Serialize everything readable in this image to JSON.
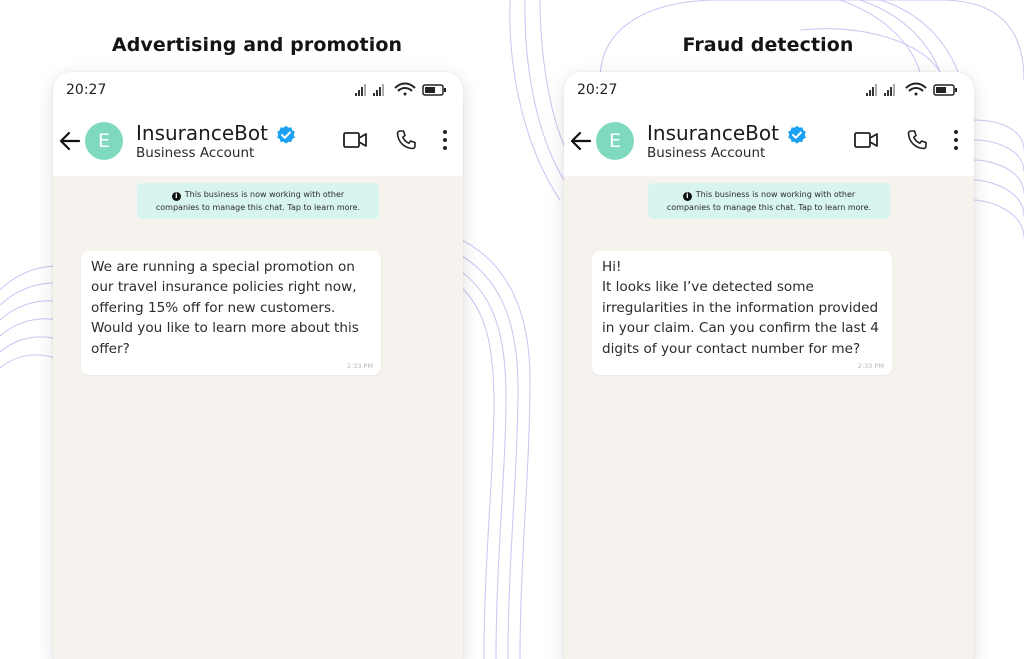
{
  "panels": [
    {
      "title": "Advertising and promotion",
      "phone": {
        "status_time": "20:27",
        "contact": {
          "avatar_letter": "E",
          "name": "InsuranceBot",
          "subtitle": "Business Account"
        },
        "icons": [
          "back-arrow-icon",
          "verified-badge-icon",
          "video-call-icon",
          "phone-call-icon",
          "more-menu-icon"
        ],
        "system_notice": "This business is now working with other\ncompanies to manage this chat. Tap to learn more.",
        "message": {
          "text": "We are running a special promotion on\nour travel insurance policies right now,\noffering 15% off for new customers.\nWould you like to learn more about this\noffer?",
          "time": "2:33 PM"
        }
      }
    },
    {
      "title": "Fraud detection",
      "phone": {
        "status_time": "20:27",
        "contact": {
          "avatar_letter": "E",
          "name": "InsuranceBot",
          "subtitle": "Business Account"
        },
        "icons": [
          "back-arrow-icon",
          "verified-badge-icon",
          "video-call-icon",
          "phone-call-icon",
          "more-menu-icon"
        ],
        "system_notice": "This business is now working with other\ncompanies to manage this chat. Tap to learn more.",
        "message": {
          "text": "Hi!\nIt looks like I’ve detected some\nirregularities in the information provided\nin your claim. Can you confirm the last 4\ndigits of your contact number for me?",
          "time": "2:33 PM"
        }
      }
    }
  ],
  "colors": {
    "avatar": "#7ed9bf",
    "verified_badge": "#1da1f2",
    "notice_bg": "#d7f4ef",
    "chat_bg": "#f6f3ef",
    "decor_lines": "#c9b6f0"
  }
}
